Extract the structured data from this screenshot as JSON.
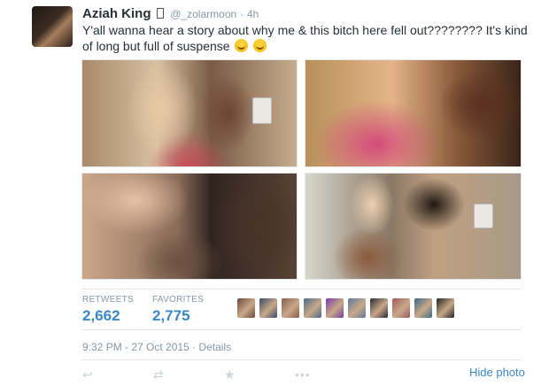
{
  "tweet": {
    "author": {
      "name": "Aziah King",
      "name_suffix_glyph": "▯",
      "handle": "@_zolarmoon",
      "time_separator": "·",
      "time": "4h"
    },
    "text": "Y'all wanna hear a story about why me & this bitch here fell out???????? It's kind of long but full of suspense",
    "emojis": [
      "laughing-crying-emoji",
      "crying-emoji"
    ],
    "photos": [
      {
        "name": "photo-1"
      },
      {
        "name": "photo-2"
      },
      {
        "name": "photo-3"
      },
      {
        "name": "photo-4"
      }
    ],
    "stats": {
      "retweets_label": "RETWEETS",
      "retweets_value": "2,662",
      "favorites_label": "FAVORITES",
      "favorites_value": "2,775"
    },
    "favoriters_count": 10,
    "favoriter_colors": [
      "#6a4a3a",
      "#3a4a66",
      "#8a5a4a",
      "#4a6a8a",
      "#7a3aa6",
      "#5a7aa0",
      "#2a2a3a",
      "#a05a5a",
      "#3a6a8a",
      "#222222"
    ],
    "timestamp": "9:32 PM - 27 Oct 2015",
    "timestamp_separator": "·",
    "details_label": "Details",
    "hide_photo_label": "Hide photo",
    "actions": [
      {
        "name": "reply-icon",
        "glyph": "↩"
      },
      {
        "name": "retweet-icon",
        "glyph": "⇄"
      },
      {
        "name": "favorite-icon",
        "glyph": "★"
      },
      {
        "name": "more-icon",
        "glyph": "•••"
      }
    ],
    "colors": {
      "link": "#3b88c3",
      "muted": "#8899a6",
      "text": "#292f33"
    }
  }
}
